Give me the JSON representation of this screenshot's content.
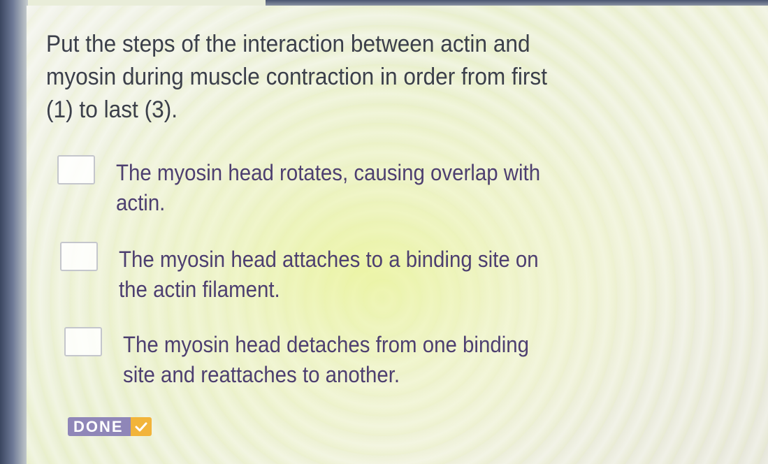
{
  "question": {
    "text": "Put the steps of the interaction between actin and myosin during muscle contraction in order from first (1) to last (3)."
  },
  "choices": [
    {
      "order_value": "",
      "text": "The myosin head rotates, causing overlap with actin."
    },
    {
      "order_value": "",
      "text": "The myosin head attaches to a binding site on the actin filament."
    },
    {
      "order_value": "",
      "text": "The myosin head detaches from one binding site and reattaches to another."
    }
  ],
  "done_button": {
    "label": "DONE",
    "icon": "checkmark-icon",
    "label_color": "#8f86b8",
    "icon_color": "#f2b43a"
  }
}
